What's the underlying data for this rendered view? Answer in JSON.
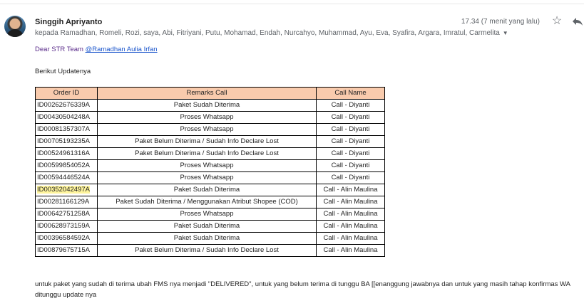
{
  "message": {
    "sender": "Singgih Apriyanto",
    "recipients": "kepada Ramadhan, Romeli, Rozi, saya, Abi, Fitriyani, Putu, Mohamad, Endah, Nurcahyo, Muhammad, Ayu, Eva, Syafira, Argara, Imratul, Carmelita",
    "time": "17.34 (7 menit yang lalu)",
    "greeting": "Dear STR Team ",
    "mention": "@Ramadhan Aulia Irfan",
    "intro": "Berikut Updatenya",
    "footer": "untuk paket yang sudah di terima ubah FMS nya menjadi \"DELIVERED\", untuk yang belum terima di tunggu BA [[enanggung jawabnya dan untuk yang masih tahap konfirmas WA ditunggu update nya"
  },
  "table": {
    "headers": [
      "Order ID",
      "Remarks Call",
      "Call Name"
    ],
    "rows": [
      [
        "ID00262676339A",
        "Paket Sudah Diterima",
        "Call - Diyanti"
      ],
      [
        "ID00430504248A",
        "Proses Whatsapp",
        "Call - Diyanti"
      ],
      [
        "ID00081357307A",
        "Proses Whatsapp",
        "Call - Diyanti"
      ],
      [
        "ID00705193235A",
        "Paket Belum Diterima / Sudah Info Declare Lost",
        "Call - Diyanti"
      ],
      [
        "ID00524961316A",
        "Paket Belum Diterima / Sudah Info Declare Lost",
        "Call - Diyanti"
      ],
      [
        "ID00599854052A",
        "Proses Whatsapp",
        "Call - Diyanti"
      ],
      [
        "ID00594446524A",
        "Proses Whatsapp",
        "Call - Diyanti"
      ],
      [
        "ID00352042497A",
        "Paket Sudah Diterima",
        "Call - Alin Maulina"
      ],
      [
        "ID00281166129A",
        "Paket Sudah Diterima / Menggunakan Atribut Shopee (COD)",
        "Call - Alin Maulina"
      ],
      [
        "ID00642751258A",
        "Proses Whatsapp",
        "Call - Alin Maulina"
      ],
      [
        "ID00628973159A",
        "Paket Sudah Diterima",
        "Call - Alin Maulina"
      ],
      [
        "ID00396584592A",
        "Paket Sudah Diterima",
        "Call - Alin Maulina"
      ],
      [
        "ID00879675715A",
        "Paket Belum Diterima / Sudah Info Declare Lost",
        "Call - Alin Maulina"
      ]
    ]
  },
  "icons": {
    "star": "star-icon",
    "reply": "reply-icon",
    "caret": "chevron-down-icon"
  },
  "colors": {
    "header_bg": "#f9cbad",
    "highlight": "#fff59d",
    "link": "#1a55cc"
  }
}
